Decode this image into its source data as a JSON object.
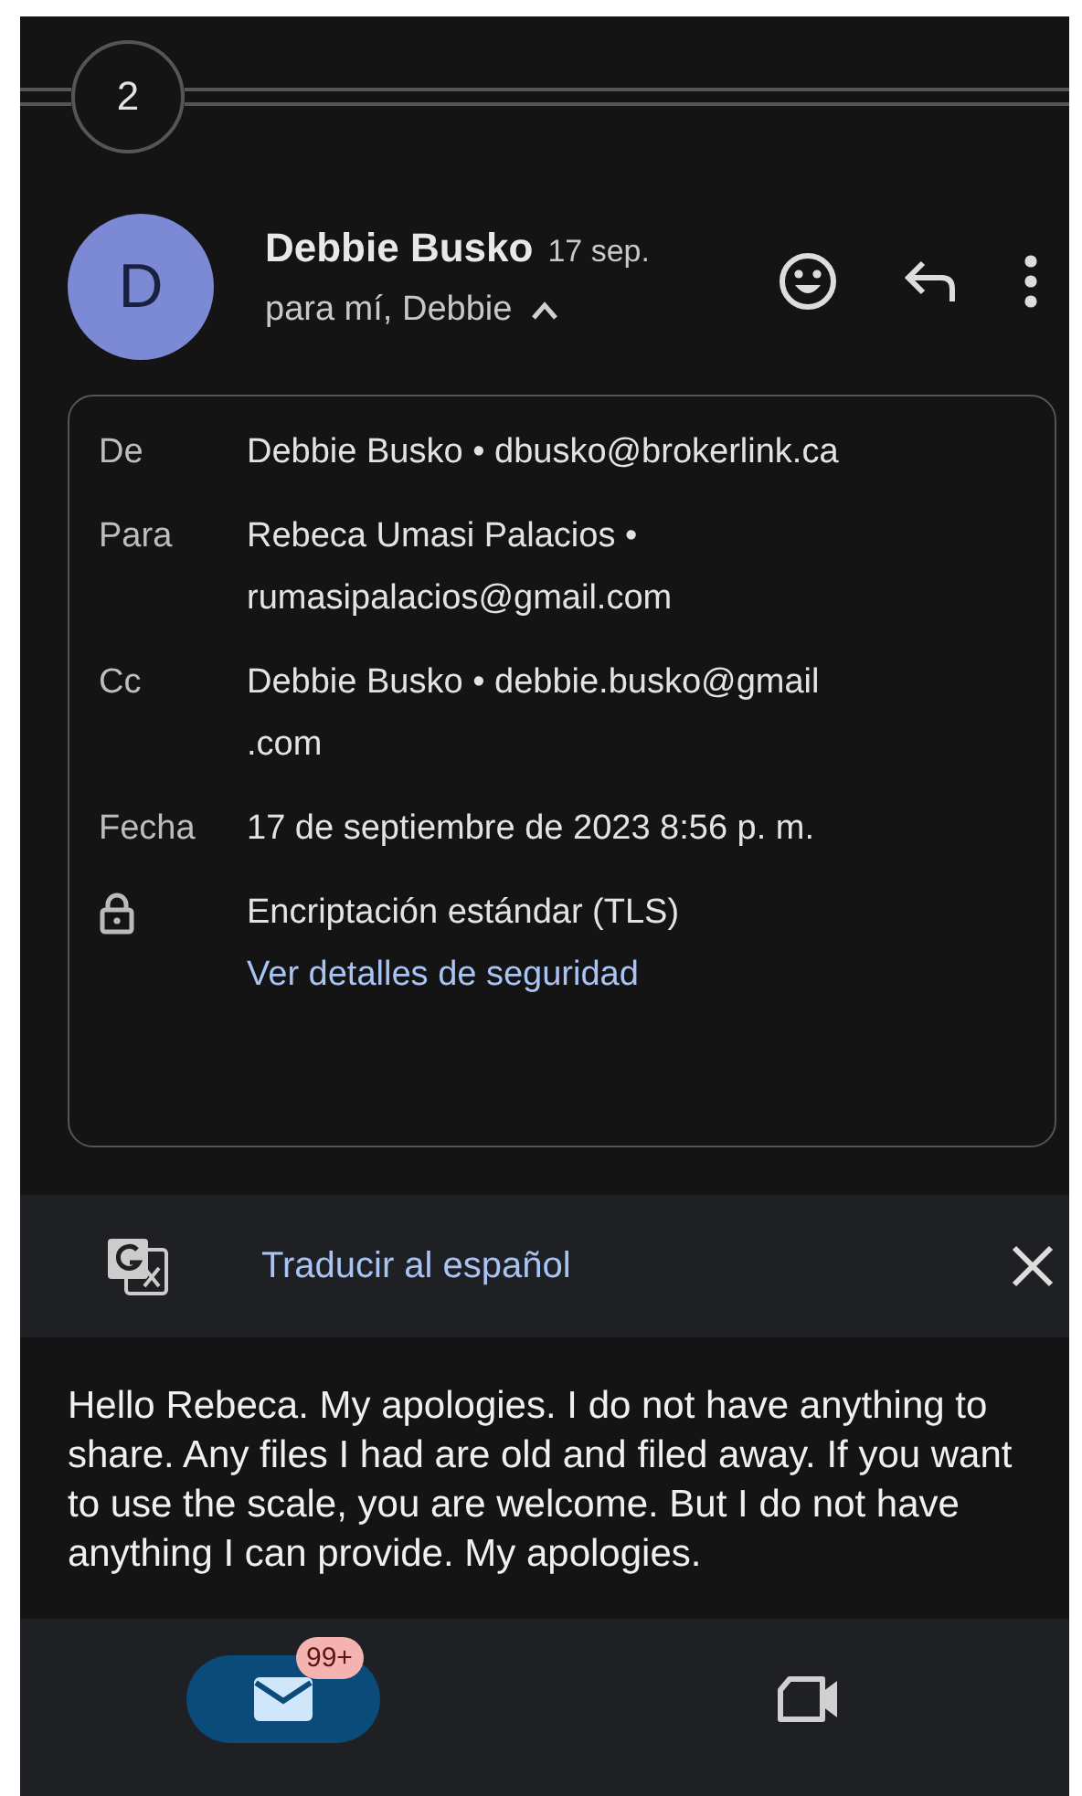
{
  "thread": {
    "count": "2"
  },
  "message": {
    "avatar": "D",
    "sender": "Debbie Busko",
    "date": "17 sep.",
    "recipients": "para mí, Debbie",
    "expanded": true
  },
  "details": [
    {
      "kind": "text",
      "label": "De",
      "lines": [
        "Debbie Busko • dbusko@brokerlink.ca"
      ]
    },
    {
      "kind": "text",
      "label": "Para",
      "lines": [
        "Rebeca Umasi Palacios •",
        "rumasipalacios@gmail.com"
      ]
    },
    {
      "kind": "text",
      "label": "Cc",
      "lines": [
        "Debbie Busko • debbie.busko@gmail",
        ".com"
      ]
    },
    {
      "kind": "text",
      "label": "Fecha",
      "lines": [
        "17 de septiembre de 2023 8:56 p. m."
      ]
    },
    {
      "kind": "security",
      "lines": [
        "Encriptación estándar (TLS)"
      ],
      "link": "Ver detalles de seguridad"
    }
  ],
  "translate": {
    "label": "Traducir al español"
  },
  "body": "Hello Rebeca. My apologies. I do not have anything to share. Any files I had are old and filed away. If you want to use the scale, you are welcome. But I do not have anything I can provide. My apologies.",
  "nav": [
    {
      "kind": "mail",
      "selected": true,
      "badge": "99+"
    },
    {
      "kind": "video",
      "selected": false
    }
  ]
}
